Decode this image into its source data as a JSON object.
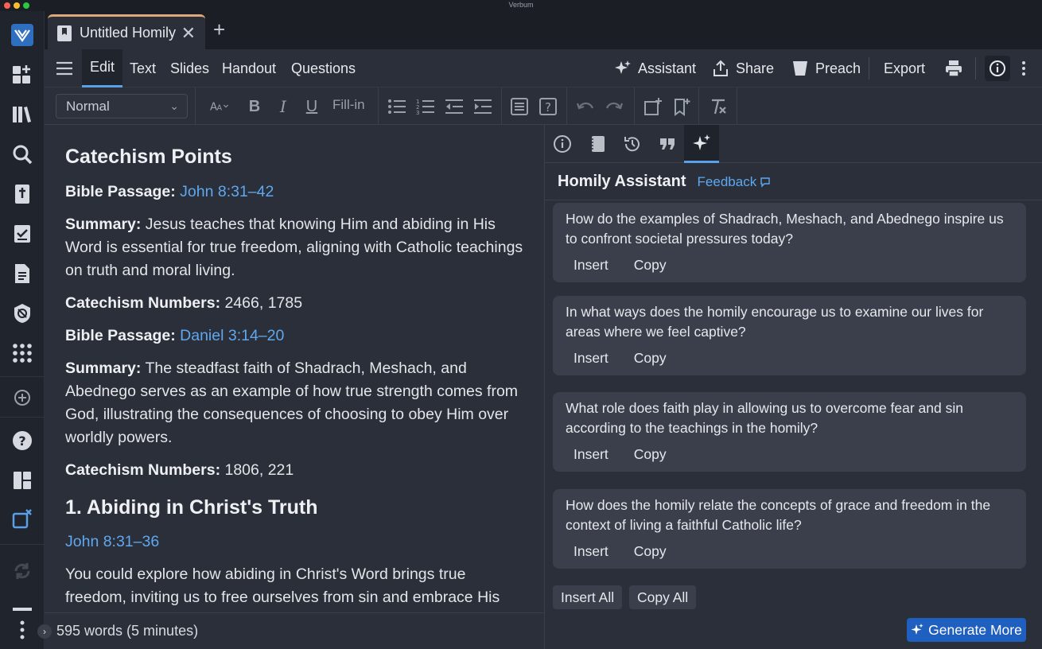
{
  "window": {
    "title": "Verbum"
  },
  "rail": {
    "icons": [
      "verbum-logo-icon",
      "dashboard-add-icon",
      "library-icon",
      "search-icon",
      "bible-icon",
      "checklist-icon",
      "document-icon",
      "no-tracking-icon",
      "apps-grid-icon",
      "add-circle-icon",
      "help-icon",
      "layout-icon",
      "close-panels-icon",
      "sync-icon",
      "more-vert-icon"
    ]
  },
  "tab": {
    "label": "Untitled Homily",
    "close": "✕",
    "new": "+"
  },
  "menu": {
    "items": [
      "Edit",
      "Text",
      "Slides",
      "Handout",
      "Questions"
    ],
    "assistant": "Assistant",
    "share": "Share",
    "preach": "Preach",
    "export": "Export"
  },
  "toolbar": {
    "style": "Normal",
    "fillin": "Fill-in"
  },
  "editor": {
    "heading": "Catechism Points",
    "blocks": [
      {
        "label": "Bible Passage:",
        "link": "John 8:31–42"
      },
      {
        "label": "Summary:",
        "text": "Jesus teaches that knowing Him and abiding in His Word is essential for true freedom, aligning with Catholic teachings on truth and moral living."
      },
      {
        "label": "Catechism Numbers:",
        "text": "2466, 1785"
      },
      {
        "label": "Bible Passage:",
        "link": "Daniel 3:14–20"
      },
      {
        "label": "Summary:",
        "text": "The steadfast faith of Shadrach, Meshach, and Abednego serves as an example of how true strength comes from God, illustrating the consequences of choosing to obey Him over worldly powers."
      },
      {
        "label": "Catechism Numbers:",
        "text": "1806, 221"
      }
    ],
    "section_heading": "1. Abiding in Christ's Truth",
    "section_link": "John 8:31–36",
    "section_text": "You could explore how abiding in Christ's Word brings true freedom, inviting us to free ourselves from sin and embrace His"
  },
  "status": {
    "word_count": "595 words (5 minutes)",
    "expander": "›"
  },
  "panel": {
    "title": "Homily Assistant",
    "feedback": "Feedback",
    "questions": [
      "How do the examples of Shadrach, Meshach, and Abednego inspire us to confront societal pressures today?",
      "In what ways does the homily encourage us to examine our lives for areas where we feel captive?",
      "What role does faith play in allowing us to overcome fear and sin according to the teachings in the homily?",
      "How does the homily relate the concepts of grace and freedom in the context of living a faithful Catholic life?"
    ],
    "insert": "Insert",
    "copy": "Copy",
    "insert_all": "Insert All",
    "copy_all": "Copy All",
    "generate_more": "Generate More"
  },
  "colors": {
    "accent": "#5aa0e8",
    "link": "#5fa8f0",
    "primary_button": "#1f5fbf",
    "tab_highlight": "#e0a77a"
  }
}
